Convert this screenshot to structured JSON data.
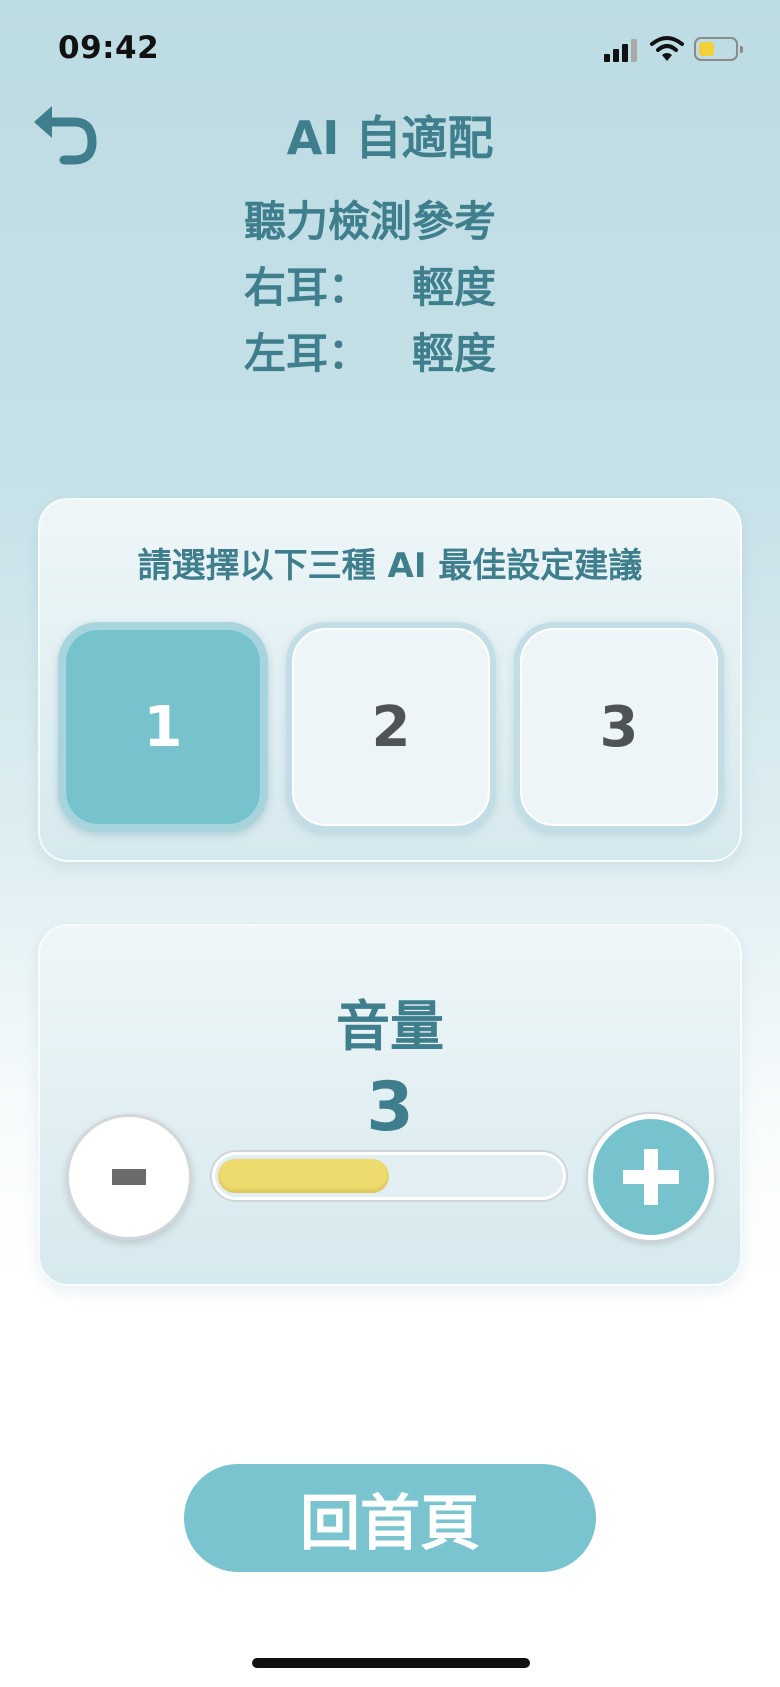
{
  "status_bar": {
    "time": "09:42",
    "battery_level": 0.45
  },
  "header": {
    "back_icon": "undo-arrow-icon",
    "title": "AI 自適配"
  },
  "hearing_info": {
    "heading": "聽力檢測參考",
    "right_ear_label": "右耳：",
    "right_ear_value": "輕度",
    "left_ear_label": "左耳：",
    "left_ear_value": "輕度"
  },
  "settings": {
    "prompt": "請選擇以下三種 AI 最佳設定建議",
    "options": [
      "1",
      "2",
      "3"
    ],
    "selected": "1"
  },
  "volume": {
    "label": "音量",
    "value": "3",
    "level_fraction": 0.5,
    "minus_label": "-",
    "plus_label": "+"
  },
  "home_button": "回首頁",
  "colors": {
    "accent": "#76c3ce",
    "text": "#3f7e8c",
    "volume_fill": "#eddb6e"
  }
}
